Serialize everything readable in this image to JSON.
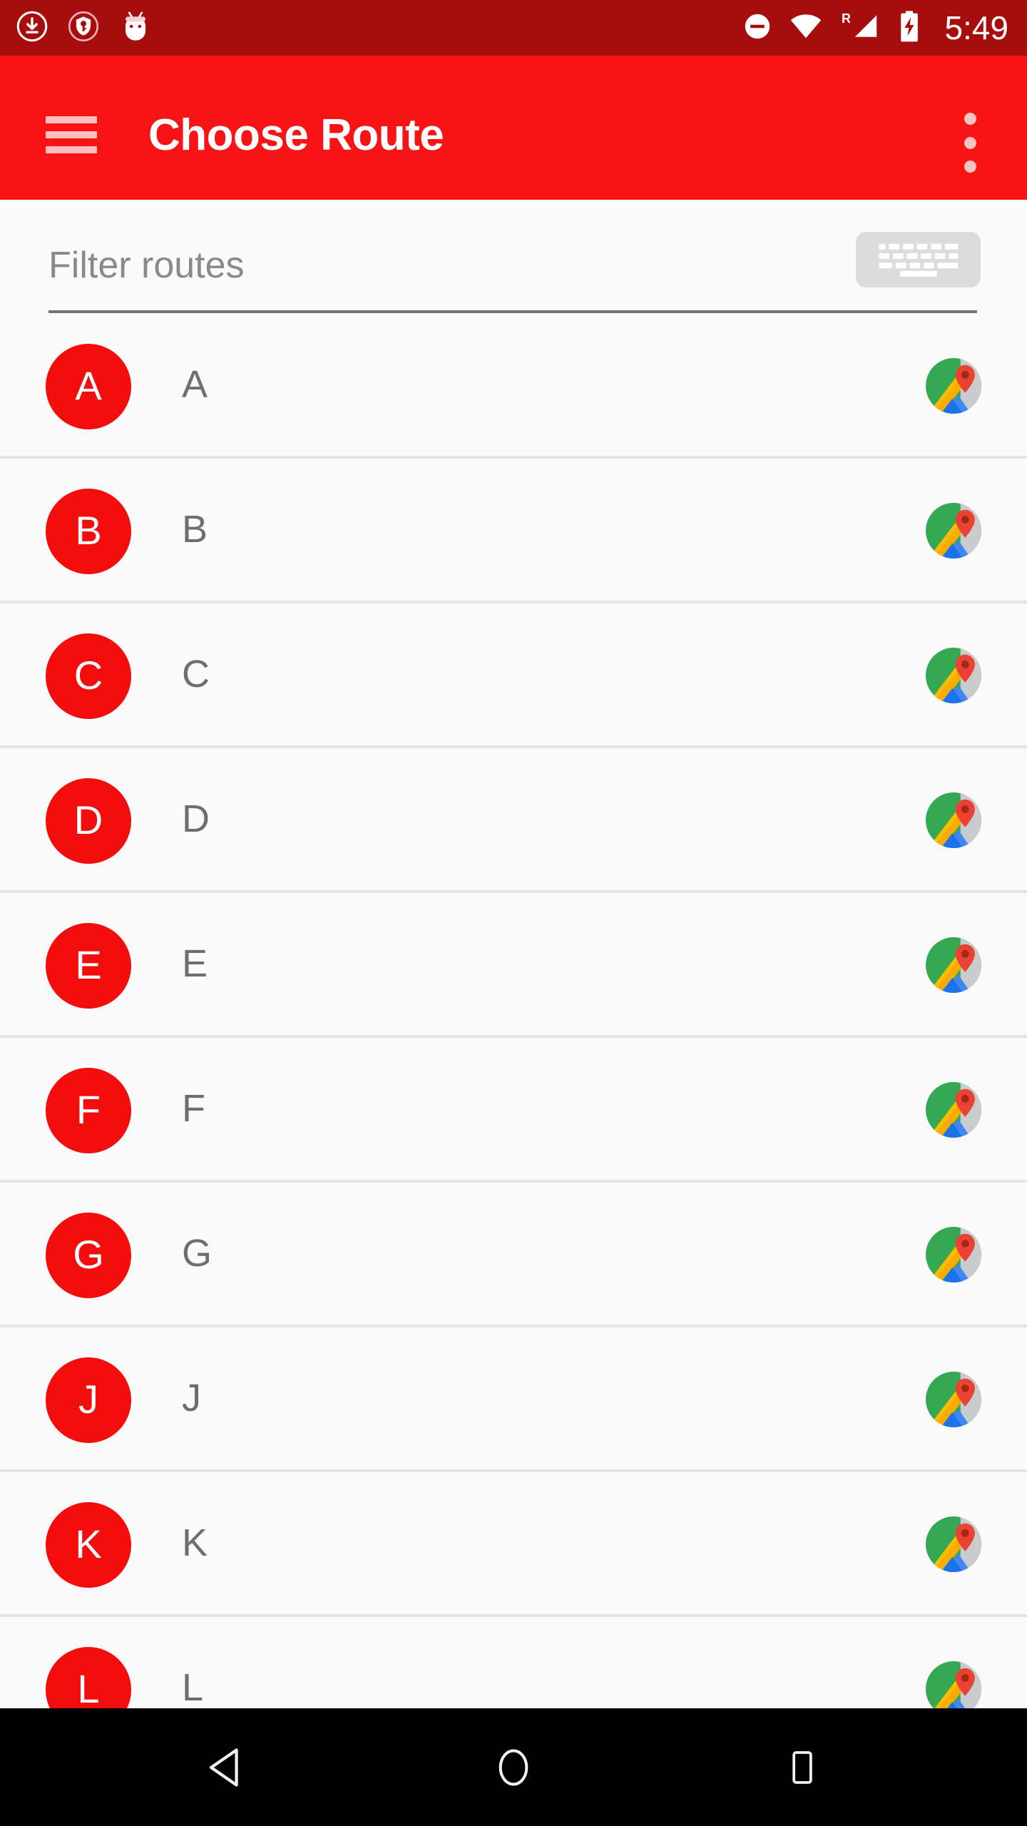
{
  "status_bar": {
    "background_color": "#a80d0d",
    "clock": "5:49",
    "left_icons": [
      {
        "name": "download-icon"
      },
      {
        "name": "vpn-key-shield-icon"
      },
      {
        "name": "android-head-icon"
      }
    ],
    "right_icons": [
      {
        "name": "do-not-disturb-icon"
      },
      {
        "name": "wifi-icon"
      },
      {
        "name": "cell-signal-roaming-icon",
        "label": "R"
      },
      {
        "name": "battery-charging-icon"
      }
    ]
  },
  "app_bar": {
    "background_color": "#f71414",
    "title": "Choose Route",
    "menu_button_name": "navigation-drawer",
    "overflow_button_name": "more-options"
  },
  "filter": {
    "placeholder": "Filter routes",
    "value": "",
    "keyboard_button_label": "keyboard-icon"
  },
  "list": {
    "avatar_color": "#f40d0d",
    "rows": [
      {
        "initial": "A",
        "label": "A",
        "action_icon": "google-maps-icon"
      },
      {
        "initial": "B",
        "label": "B",
        "action_icon": "google-maps-icon"
      },
      {
        "initial": "C",
        "label": "C",
        "action_icon": "google-maps-icon"
      },
      {
        "initial": "D",
        "label": "D",
        "action_icon": "google-maps-icon"
      },
      {
        "initial": "E",
        "label": "E",
        "action_icon": "google-maps-icon"
      },
      {
        "initial": "F",
        "label": "F",
        "action_icon": "google-maps-icon"
      },
      {
        "initial": "G",
        "label": "G",
        "action_icon": "google-maps-icon"
      },
      {
        "initial": "J",
        "label": "J",
        "action_icon": "google-maps-icon"
      },
      {
        "initial": "K",
        "label": "K",
        "action_icon": "google-maps-icon"
      },
      {
        "initial": "L",
        "label": "L",
        "action_icon": "google-maps-icon"
      }
    ]
  },
  "nav_bar": {
    "background_color": "#000000",
    "buttons": [
      {
        "name": "back-button"
      },
      {
        "name": "home-button"
      },
      {
        "name": "recents-button"
      }
    ]
  }
}
